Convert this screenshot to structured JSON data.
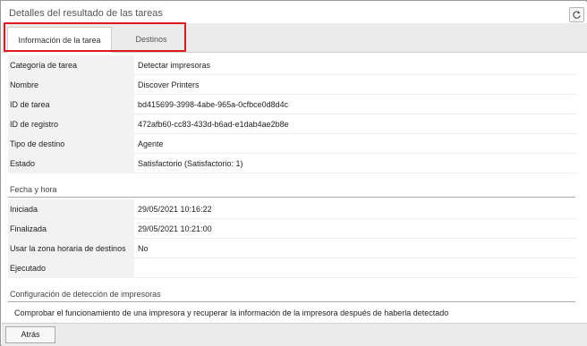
{
  "window": {
    "title": "Detalles del resultado de las tareas",
    "refresh_icon": "refresh-icon"
  },
  "tabs": [
    {
      "label": "Información de la tarea",
      "active": true
    },
    {
      "label": "Destinos",
      "active": false
    }
  ],
  "highlight_color": "#e0191e",
  "task_info": [
    {
      "label": "Categoría de tarea",
      "value": "Detectar impresoras"
    },
    {
      "label": "Nombre",
      "value": "Discover Printers"
    },
    {
      "label": "ID de tarea",
      "value": "bd415699-3998-4abe-965a-0cfbce0d8d4c"
    },
    {
      "label": "ID de registro",
      "value": "472afb60-cc83-433d-b6ad-e1dab4ae2b8e"
    },
    {
      "label": "Tipo de destino",
      "value": "Agente"
    },
    {
      "label": "Estado",
      "value": "Satisfactorio (Satisfactorio: 1)"
    }
  ],
  "datetime_section": {
    "title": "Fecha y hora",
    "rows": [
      {
        "label": "Iniciada",
        "value": "29/05/2021 10:16:22"
      },
      {
        "label": "Finalizada",
        "value": "29/05/2021 10:21:00"
      },
      {
        "label": "Usar la zona horaria de destinos",
        "value": "No"
      },
      {
        "label": "Ejecutado",
        "value": ""
      }
    ]
  },
  "printer_detection": {
    "title": "Configuración de detección de impresoras",
    "description": "Comprobar el funcionamiento de una impresora y recuperar la información de la impresora después de haberla detectado"
  },
  "footer": {
    "back_label": "Atrás"
  }
}
